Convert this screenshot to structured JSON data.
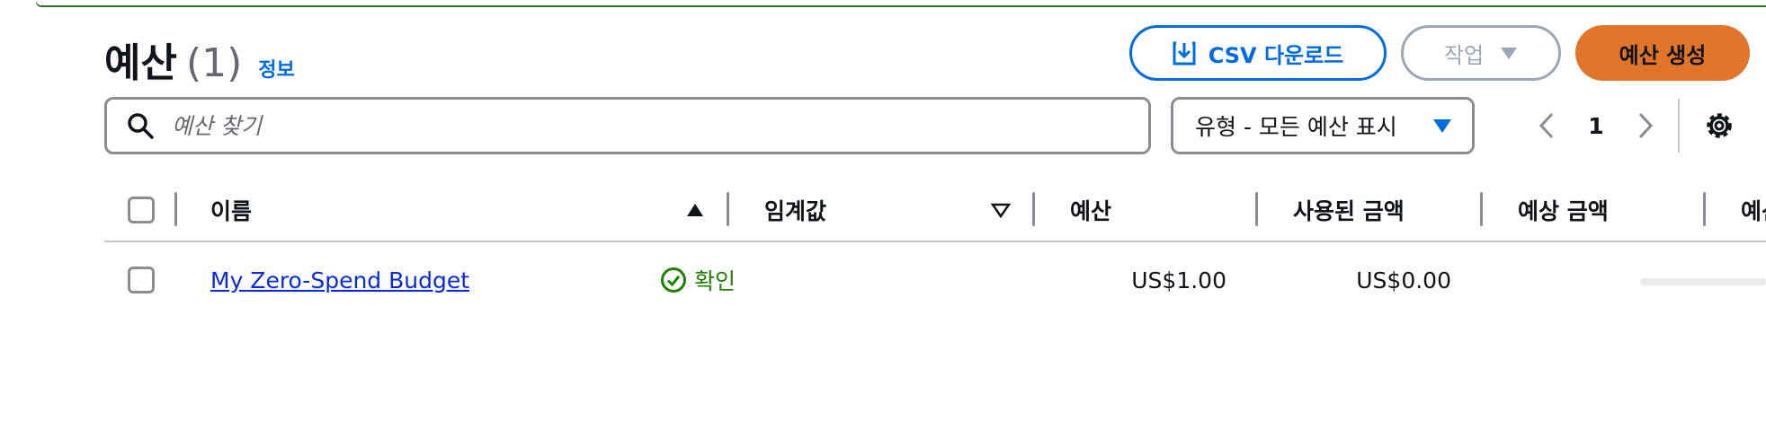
{
  "header": {
    "title": "예산",
    "count": "(1)",
    "info_link": "정보"
  },
  "toolbar": {
    "csv_label": "CSV 다운로드",
    "actions_label": "작업",
    "create_label": "예산 생성"
  },
  "search": {
    "placeholder": "예산 찾기",
    "value": ""
  },
  "filter": {
    "selected": "유형 - 모든 예산 표시"
  },
  "pagination": {
    "current_page": "1"
  },
  "table": {
    "columns": [
      "이름",
      "임계값",
      "예산",
      "사용된 금액",
      "예상 금액",
      "예산 대비 %"
    ],
    "rows": [
      {
        "name": "My Zero-Spend Budget",
        "threshold": "확인",
        "budget": "US$1.00",
        "spent": "US$0.00",
        "forecast": "-"
      }
    ]
  },
  "colors": {
    "accent": "#006ce0",
    "primary_button": "#e07428",
    "success": "#1d8102",
    "banner": "#2e6f1e"
  }
}
